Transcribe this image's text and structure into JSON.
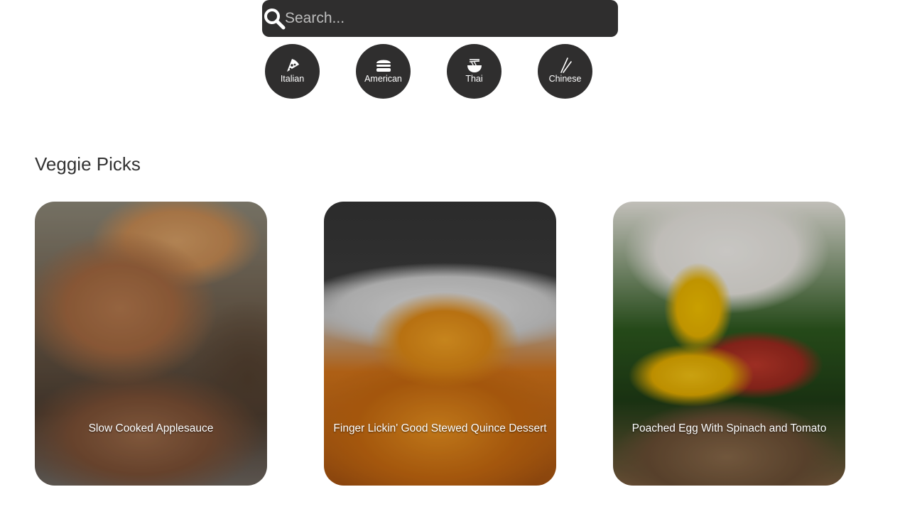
{
  "search": {
    "placeholder": "Search..."
  },
  "cuisines": [
    {
      "label": "Italian",
      "icon": "pizza-icon"
    },
    {
      "label": "American",
      "icon": "burger-icon"
    },
    {
      "label": "Thai",
      "icon": "noodle-bowl-icon"
    },
    {
      "label": "Chinese",
      "icon": "chopsticks-icon"
    }
  ],
  "section": {
    "title": "Veggie Picks"
  },
  "cards": [
    {
      "title": "Slow Cooked Applesauce"
    },
    {
      "title": "Finger Lickin' Good Stewed Quince Dessert"
    },
    {
      "title": "Poached Egg With Spinach and Tomato"
    }
  ],
  "colors": {
    "dark_surface": "#2f2e2e",
    "text": "#333333",
    "on_dark": "#ffffff"
  }
}
